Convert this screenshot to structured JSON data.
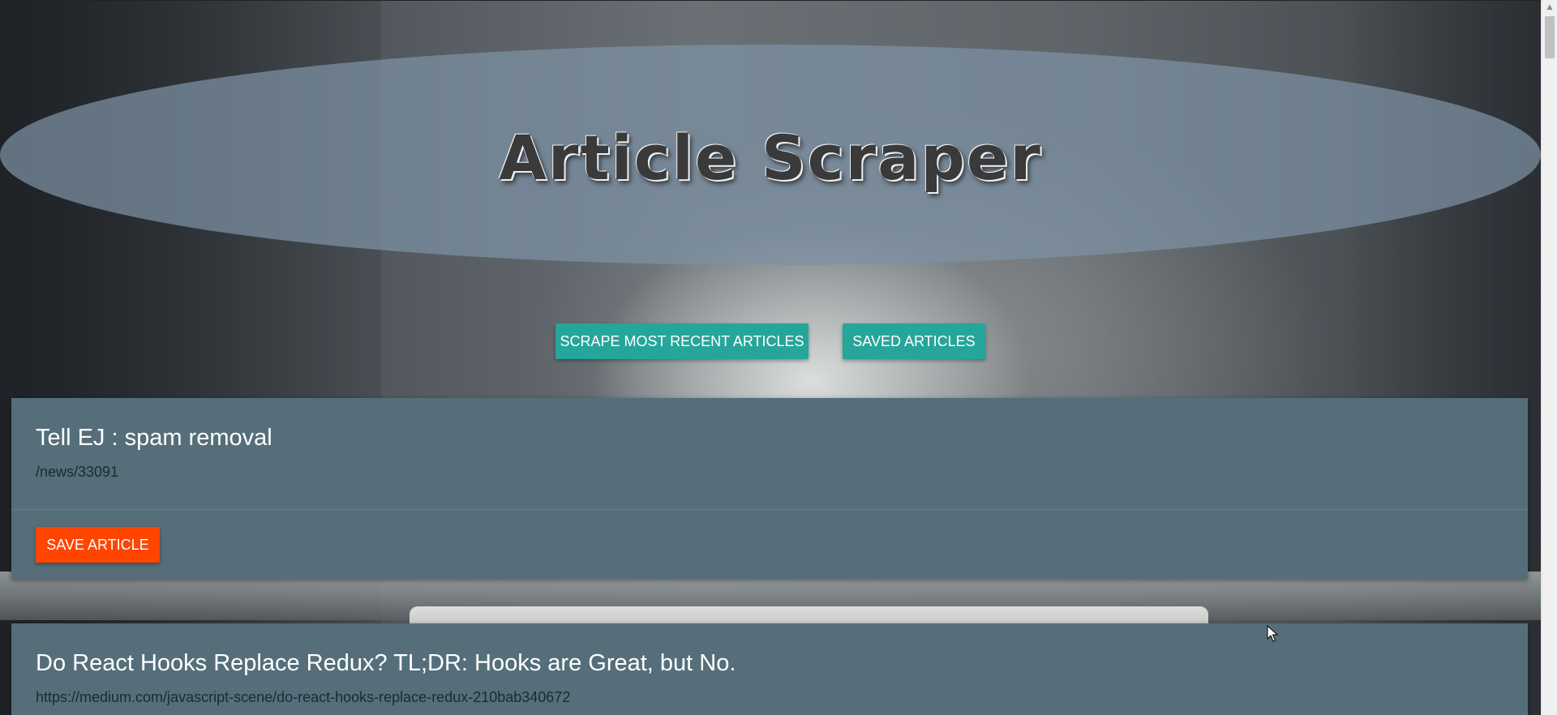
{
  "header": {
    "title": "Article Scraper"
  },
  "actions": {
    "scrape_label": "Scrape Most Recent Articles",
    "saved_label": "Saved Articles"
  },
  "articles": [
    {
      "title": "Tell EJ : spam removal",
      "link": "/news/33091",
      "save_label": "Save Article"
    },
    {
      "title": "Do React Hooks Replace Redux? TL;DR: Hooks are Great, but No.",
      "link": "https://medium.com/javascript-scene/do-react-hooks-replace-redux-210bab340672"
    }
  ],
  "colors": {
    "teal": "#26a69a",
    "orange": "#ff4500",
    "card": "#556e7a"
  },
  "icons": {
    "scroll_up": "chevron-up-icon",
    "cursor": "mouse-pointer-icon"
  }
}
